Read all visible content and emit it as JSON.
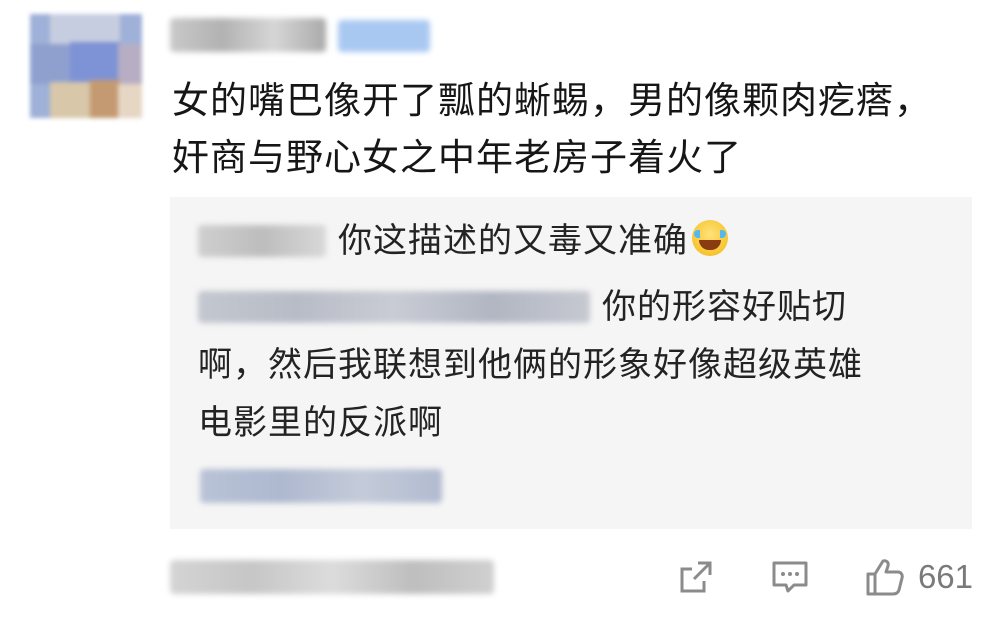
{
  "comment": {
    "lines": [
      "女的嘴巴像开了瓢的蜥蜴，男的像颗肉疙瘩，",
      "奸商与野心女之中年老房子着火了"
    ]
  },
  "replies": [
    {
      "text": "你这描述的又毒又准确",
      "emoji": "laughing-crying-emoji"
    },
    {
      "lines": [
        "你的形容好贴切",
        "啊，然后我联想到他俩的形象好像超级英雄",
        "电影里的反派啊"
      ]
    }
  ],
  "actions": {
    "like_count": "661"
  },
  "colors": {
    "reply_background": "#f5f5f5",
    "icon_gray": "#8b8b8b"
  }
}
